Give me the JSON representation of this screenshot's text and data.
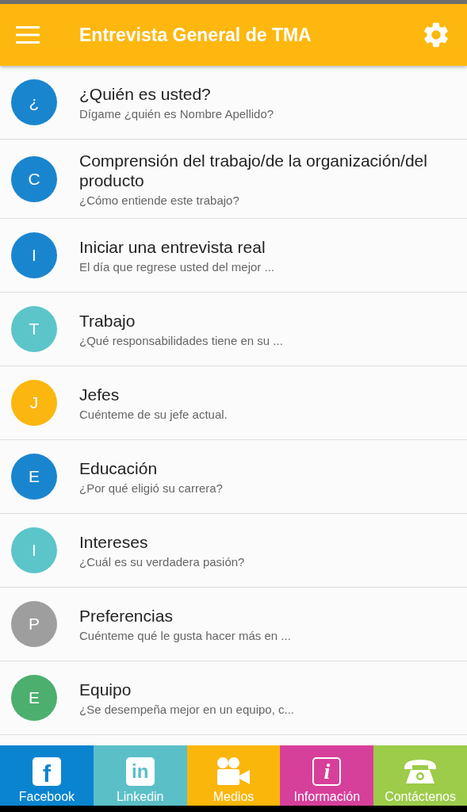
{
  "app_bar": {
    "title": "Entrevista General de TMA"
  },
  "topics": [
    {
      "letter": "¿",
      "color": "#1a85cf",
      "title": "¿Quién es usted?",
      "subtitle": "Dígame ¿quién es Nombre Apellido?"
    },
    {
      "letter": "C",
      "color": "#1a85cf",
      "title": "Comprensión del trabajo/de la organización/del producto",
      "subtitle": "¿Cómo entiende este trabajo?"
    },
    {
      "letter": "I",
      "color": "#1a85cf",
      "title": "Iniciar una entrevista real",
      "subtitle": "El día que regrese usted del mejor ..."
    },
    {
      "letter": "T",
      "color": "#5cc5c9",
      "title": "Trabajo",
      "subtitle": "¿Qué responsabilidades tiene en su ..."
    },
    {
      "letter": "J",
      "color": "#fbb60f",
      "title": "Jefes",
      "subtitle": "Cuénteme de su jefe actual."
    },
    {
      "letter": "E",
      "color": "#1a85cf",
      "title": "Educación",
      "subtitle": "¿Por qué eligió su carrera?"
    },
    {
      "letter": "I",
      "color": "#5cc5c9",
      "title": "Intereses",
      "subtitle": "¿Cuál es su verdadera pasión?"
    },
    {
      "letter": "P",
      "color": "#9e9e9e",
      "title": "Preferencias",
      "subtitle": "Cuénteme qué le gusta hacer más en ..."
    },
    {
      "letter": "E",
      "color": "#4caf6e",
      "title": "Equipo",
      "subtitle": "¿Se desempeña mejor en un equipo, c..."
    }
  ],
  "bottom_nav": [
    {
      "kind": "facebook",
      "icon_text": "f",
      "label": "Facebook",
      "color": "#0b84d0"
    },
    {
      "kind": "linkedin",
      "icon_text": "in",
      "label": "Linkedin",
      "color": "#5bbfc8"
    },
    {
      "kind": "media",
      "label": "Medios",
      "color": "#fbb60c"
    },
    {
      "kind": "info",
      "icon_text": "i",
      "label": "Información",
      "color": "#d7409a"
    },
    {
      "kind": "phone",
      "label": "Contáctenos",
      "color": "#9dcb4a"
    }
  ]
}
